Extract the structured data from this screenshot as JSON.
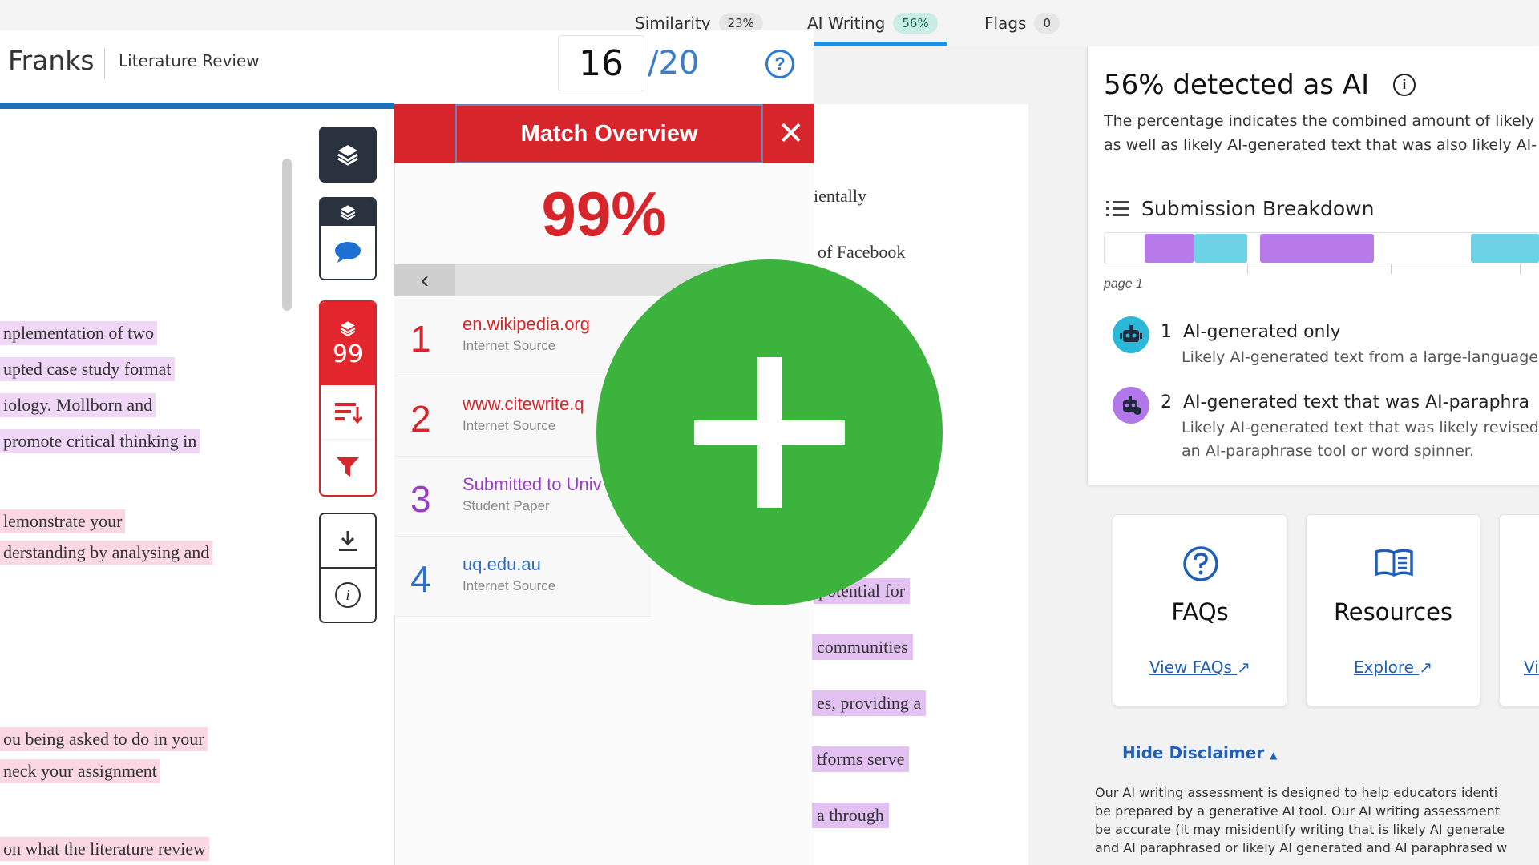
{
  "top_tabs": [
    {
      "label": "Similarity",
      "badge": "23%"
    },
    {
      "label": "AI Writing",
      "badge": "56%"
    },
    {
      "label": "Flags",
      "badge": "0"
    }
  ],
  "header": {
    "student_name": "Franks",
    "assignment": "Literature Review",
    "score": "16",
    "score_max": "/20",
    "help_icon": "help-circle-icon"
  },
  "left_doc_lines": [
    "nplementation of two",
    "upted case study format",
    "iology.  Mollborn and",
    "promote critical thinking in",
    "lemonstrate your",
    "derstanding by analysing and",
    "ou being asked to do in your",
    "neck your assignment",
    "on what the literature review"
  ],
  "tools": {
    "similarity_score": "99",
    "icons": [
      "layers-icon",
      "comment-icon",
      "sort-icon",
      "filter-icon",
      "download-icon",
      "info-icon"
    ]
  },
  "match_overview": {
    "title": "Match Overview",
    "percent": "99%",
    "matches": [
      {
        "num": "1",
        "source": "en.wikipedia.org",
        "type": "Internet Source",
        "color": "#d6262c"
      },
      {
        "num": "2",
        "source": "www.citewrite.q",
        "type": "Internet Source",
        "color": "#d6262c"
      },
      {
        "num": "3",
        "source": "Submitted to Univ",
        "type": "Student Paper",
        "color": "#9b3dc4"
      },
      {
        "num": "4",
        "source": "uq.edu.au",
        "type": "Internet Source",
        "color": "#2f6fc6"
      }
    ]
  },
  "mid_doc": {
    "plain": [
      "ientally",
      "of Facebook"
    ],
    "highlighted": [
      "potential for",
      "communities",
      "es, providing a",
      "tforms serve",
      "a through"
    ]
  },
  "ai_panel": {
    "title": "56% detected as AI",
    "description_line1": "The percentage indicates the combined amount of likely",
    "description_line2": "as well as likely AI-generated text that was also likely AI-p",
    "breakdown_title": "Submission Breakdown",
    "page_label": "page 1",
    "legend": [
      {
        "num": "1",
        "title": "AI-generated only",
        "desc": [
          "Likely AI-generated text from a large-language"
        ]
      },
      {
        "num": "2",
        "title": "AI-generated text that was AI-paraphra",
        "desc": [
          "Likely AI-generated text that was likely revised",
          "an AI-paraphrase tool or word spinner."
        ]
      }
    ],
    "colors": {
      "ai_only": "#2bb8d8",
      "ai_paraphrased": "#b277e8",
      "bar_cyan": "#6cd3e6",
      "bar_purple": "#b87ae8"
    }
  },
  "cards": [
    {
      "title": "FAQs",
      "link": "View FAQs",
      "icon": "help-circle-icon"
    },
    {
      "title": "Resources",
      "link": "Explore",
      "icon": "book-icon"
    },
    {
      "title": "",
      "link": "Vi",
      "icon": ""
    }
  ],
  "disclaimer": {
    "toggle": "Hide Disclaimer",
    "lines": [
      "Our AI writing assessment is designed to help educators identi",
      "be prepared by a generative AI tool. Our AI writing assessment",
      "be accurate (it may misidentify writing that is likely AI generate",
      "and AI paraphrased or likely AI generated and AI paraphrased w"
    ]
  },
  "overlay": {
    "icon": "plus-icon",
    "color": "#3cb33c"
  }
}
